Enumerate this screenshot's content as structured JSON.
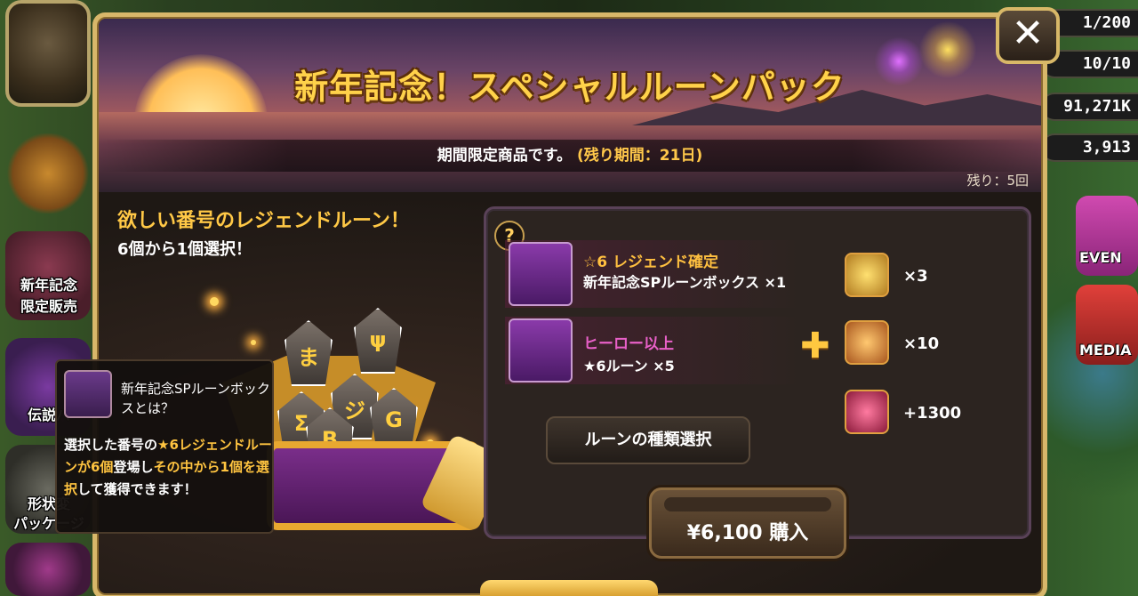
{
  "left_menu": {
    "items": [
      {
        "label_1": "新年記念",
        "label_2": "限定販売"
      },
      {
        "label_1": "伝説パ",
        "label_2": ""
      },
      {
        "label_1": "形状変",
        "label_2": "パッケージ"
      }
    ]
  },
  "right_menu": {
    "stats": [
      "1/200",
      "10/10",
      "91,271K",
      "3,913"
    ],
    "event_label": "EVEN",
    "media_label": "MEDIA"
  },
  "modal": {
    "title": "新年記念！スペシャルルーンパック",
    "period_text": "期間限定商品です。",
    "period_remaining": "(残り期間：21日)",
    "remaining_count": "残り：5回",
    "headline": "欲しい番号のレジェンドルーン！",
    "subline": "6個から1個選択！",
    "close_label": "✕",
    "help_label": "?",
    "tooltip": {
      "title": "新年記念SPルーンボックスとは？",
      "body_1": "選択した番号の",
      "body_2": "★6レジェンドルーンが6個",
      "body_3": "登場し",
      "body_4": "その中から1個を選択",
      "body_5": "して獲得できます！"
    },
    "items": [
      {
        "line1": "☆6 レジェンド確定",
        "line2": "新年記念SPルーンボックス ×1"
      },
      {
        "line1": "ヒーロー以上",
        "line2": "★6ルーン ×5"
      }
    ],
    "plus": "✚",
    "bonuses": [
      {
        "amount": "×3",
        "icon": "rainbowmon-icon",
        "color": "#e0b040"
      },
      {
        "amount": "×10",
        "icon": "scroll-icon",
        "color": "#d88a30"
      },
      {
        "amount": "+1300",
        "icon": "crystal-icon",
        "color": "#d0406a"
      }
    ],
    "select_button": "ルーンの種類選択",
    "buy_button": "¥6,100 購入"
  }
}
